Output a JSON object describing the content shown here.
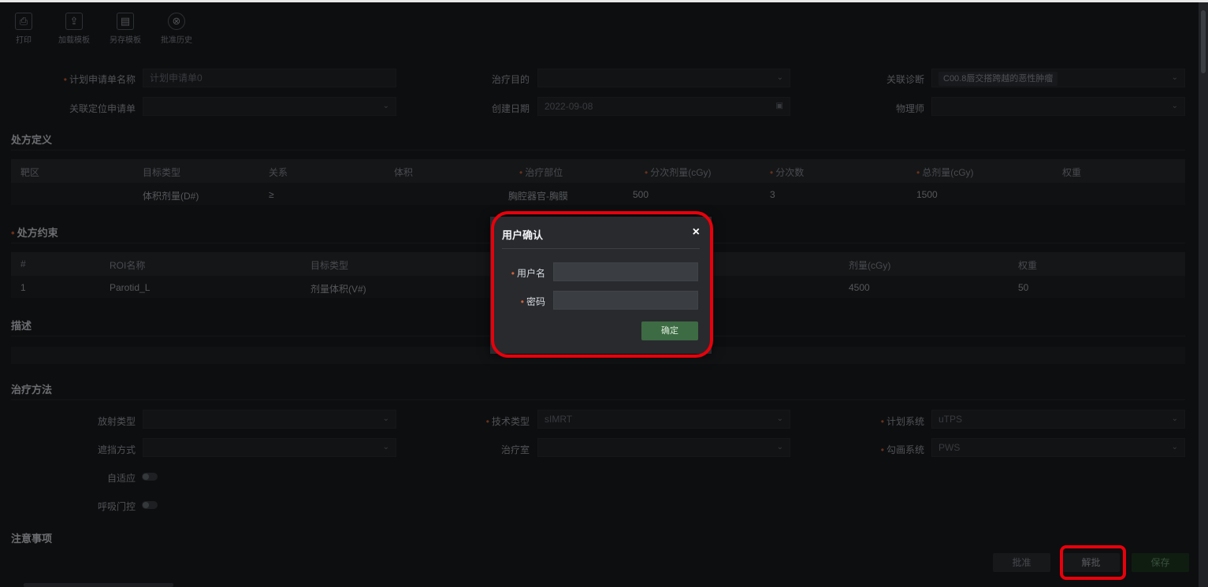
{
  "toolbar": {
    "items": [
      {
        "label": "打印",
        "icon": "printer-icon",
        "glyph": "⎙"
      },
      {
        "label": "加载模板",
        "icon": "load-template-icon",
        "glyph": "⇪"
      },
      {
        "label": "另存模板",
        "icon": "save-template-icon",
        "glyph": "▤"
      },
      {
        "label": "批准历史",
        "icon": "approval-history-icon",
        "glyph": "⊗"
      }
    ]
  },
  "form": {
    "plan_name": {
      "label": "计划申请单名称",
      "placeholder": "计划申请单0"
    },
    "treatment_purpose": {
      "label": "治疗目的",
      "value": ""
    },
    "related_diagnosis": {
      "label": "关联诊断",
      "value": "C00.8唇交搭跨越的恶性肿瘤"
    },
    "related_location": {
      "label": "关联定位申请单",
      "value": ""
    },
    "create_date": {
      "label": "创建日期",
      "value": "2022-09-08"
    },
    "physicist": {
      "label": "物理师",
      "value": ""
    }
  },
  "prescription_definition": {
    "title": "处方定义",
    "headers": [
      "靶区",
      "目标类型",
      "关系",
      "体积",
      "治疗部位",
      "分次剂量(cGy)",
      "分次数",
      "总剂量(cGy)",
      "权重"
    ],
    "required_headers": [
      false,
      false,
      false,
      false,
      true,
      true,
      true,
      true,
      false
    ],
    "rows": [
      [
        "",
        "体积剂量(D#)",
        "≥",
        "",
        "胸腔器官-胸膜",
        "500",
        "3",
        "1500",
        ""
      ]
    ]
  },
  "prescription_constraint": {
    "title": "处方约束",
    "headers": [
      "#",
      "ROI名称",
      "目标类型",
      "剂量(cGy)",
      "权重"
    ],
    "rows": [
      [
        "1",
        "Parotid_L",
        "剂量体积(V#)",
        "4500",
        "50"
      ]
    ]
  },
  "description": {
    "title": "描述"
  },
  "treatment_method": {
    "title": "治疗方法",
    "radiation_type": {
      "label": "放射类型",
      "value": ""
    },
    "technique_type": {
      "label": "技术类型",
      "value": "sIMRT"
    },
    "planning_system": {
      "label": "计划系统",
      "value": "uTPS"
    },
    "blocking_method": {
      "label": "遮挡方式",
      "value": ""
    },
    "treatment_room": {
      "label": "治疗室",
      "value": ""
    },
    "contouring_system": {
      "label": "勾画系统",
      "value": "PWS"
    },
    "adaptive": {
      "label": "自适应",
      "on": false
    },
    "respiratory_gating": {
      "label": "呼吸门控",
      "on": false
    }
  },
  "notes": {
    "title": "注意事项"
  },
  "footer": {
    "approve": "批准",
    "unapprove": "解批",
    "save": "保存"
  },
  "dialog": {
    "title": "用户确认",
    "close": "×",
    "username_label": "用户名",
    "password_label": "密码",
    "confirm": "确定"
  },
  "colors": {
    "highlight": "#e8000b",
    "confirm_button": "#3d6b43",
    "save_button": "#1f3a23"
  }
}
